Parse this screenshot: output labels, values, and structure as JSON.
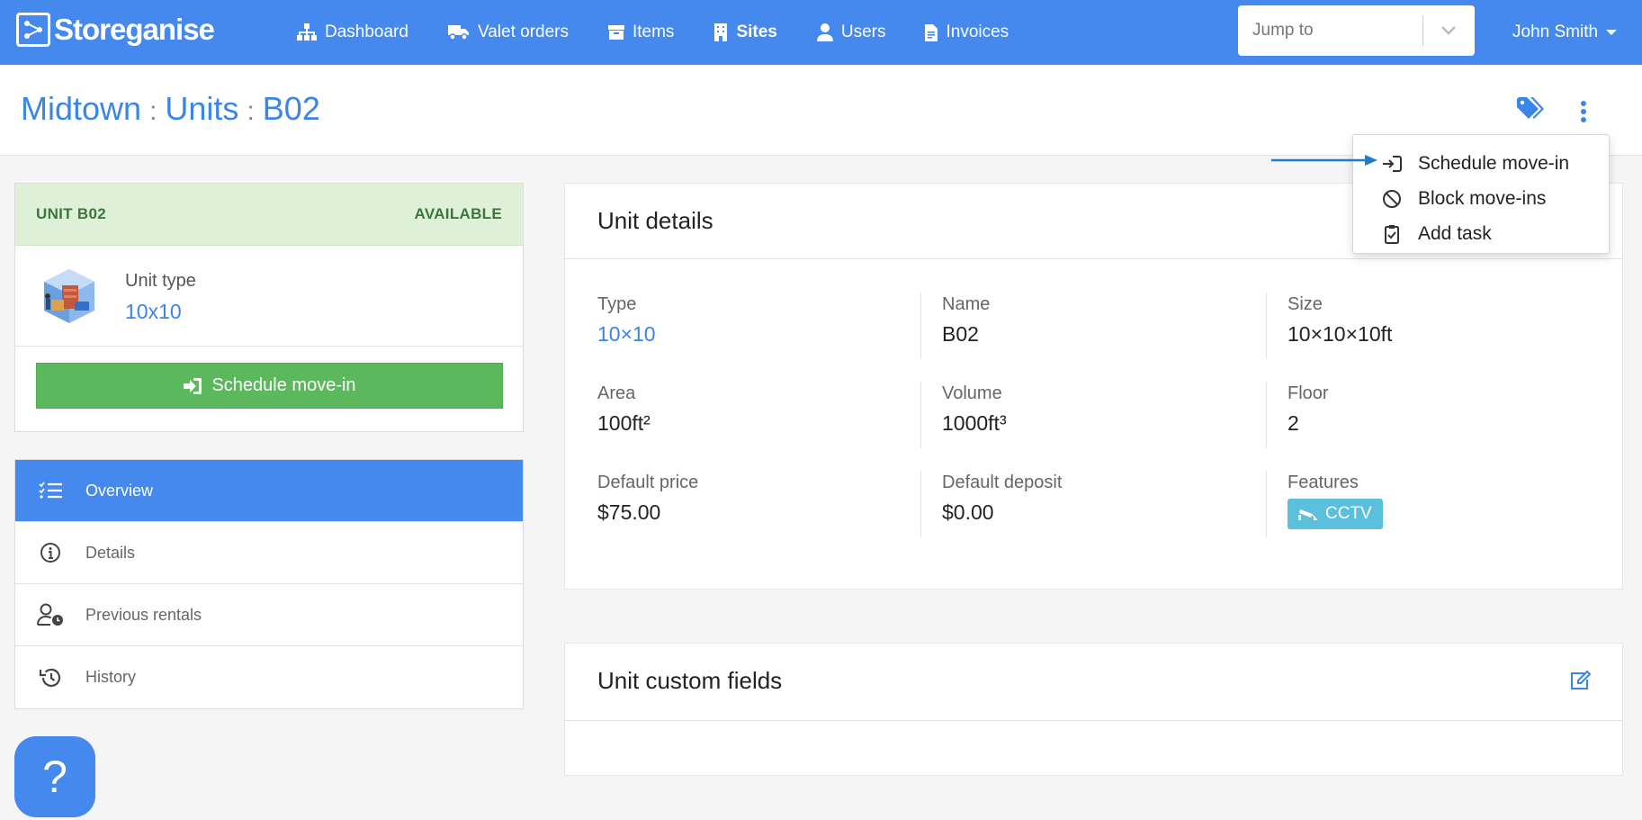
{
  "brand": {
    "name": "Storeganise"
  },
  "nav": {
    "items": [
      {
        "label": "Dashboard",
        "icon": "sitemap-icon"
      },
      {
        "label": "Valet orders",
        "icon": "truck-icon"
      },
      {
        "label": "Items",
        "icon": "archive-icon"
      },
      {
        "label": "Sites",
        "icon": "building-icon",
        "active": true
      },
      {
        "label": "Users",
        "icon": "user-icon"
      },
      {
        "label": "Invoices",
        "icon": "file-invoice-icon"
      }
    ],
    "jump_placeholder": "Jump to",
    "user_name": "John Smith"
  },
  "breadcrumb": {
    "site": "Midtown",
    "section": "Units",
    "unit": "B02",
    "separator": ":"
  },
  "actions_menu": {
    "items": [
      {
        "label": "Schedule move-in",
        "icon": "sign-in-icon"
      },
      {
        "label": "Block move-ins",
        "icon": "ban-icon"
      },
      {
        "label": "Add task",
        "icon": "clipboard-check-icon"
      }
    ]
  },
  "unit_card": {
    "title": "UNIT B02",
    "status": "AVAILABLE",
    "unit_type_label": "Unit type",
    "unit_type_value": "10x10",
    "schedule_button": "Schedule move-in"
  },
  "side_menu": {
    "items": [
      {
        "label": "Overview",
        "icon": "list-check-icon",
        "active": true
      },
      {
        "label": "Details",
        "icon": "info-circle-icon"
      },
      {
        "label": "Previous rentals",
        "icon": "user-clock-icon"
      },
      {
        "label": "History",
        "icon": "history-icon"
      }
    ]
  },
  "help": {
    "label": "?"
  },
  "unit_details": {
    "title": "Unit details",
    "fields": {
      "type": {
        "label": "Type",
        "value": "10×10"
      },
      "name": {
        "label": "Name",
        "value": "B02"
      },
      "size": {
        "label": "Size",
        "value": "10×10×10ft"
      },
      "area": {
        "label": "Area",
        "value": "100ft²"
      },
      "volume": {
        "label": "Volume",
        "value": "1000ft³"
      },
      "floor": {
        "label": "Floor",
        "value": "2"
      },
      "default_price": {
        "label": "Default price",
        "value": "$75.00"
      },
      "default_deposit": {
        "label": "Default deposit",
        "value": "$0.00"
      },
      "features": {
        "label": "Features",
        "value": "CCTV"
      }
    }
  },
  "custom_fields": {
    "title": "Unit custom fields"
  },
  "colors": {
    "primary": "#4589ee",
    "link": "#3a86e8",
    "success": "#5cb85c",
    "success_bg": "#dff0d8",
    "success_text": "#3c763d",
    "info_badge": "#5bc0de",
    "annotation_arrow": "#1f7bd0"
  }
}
